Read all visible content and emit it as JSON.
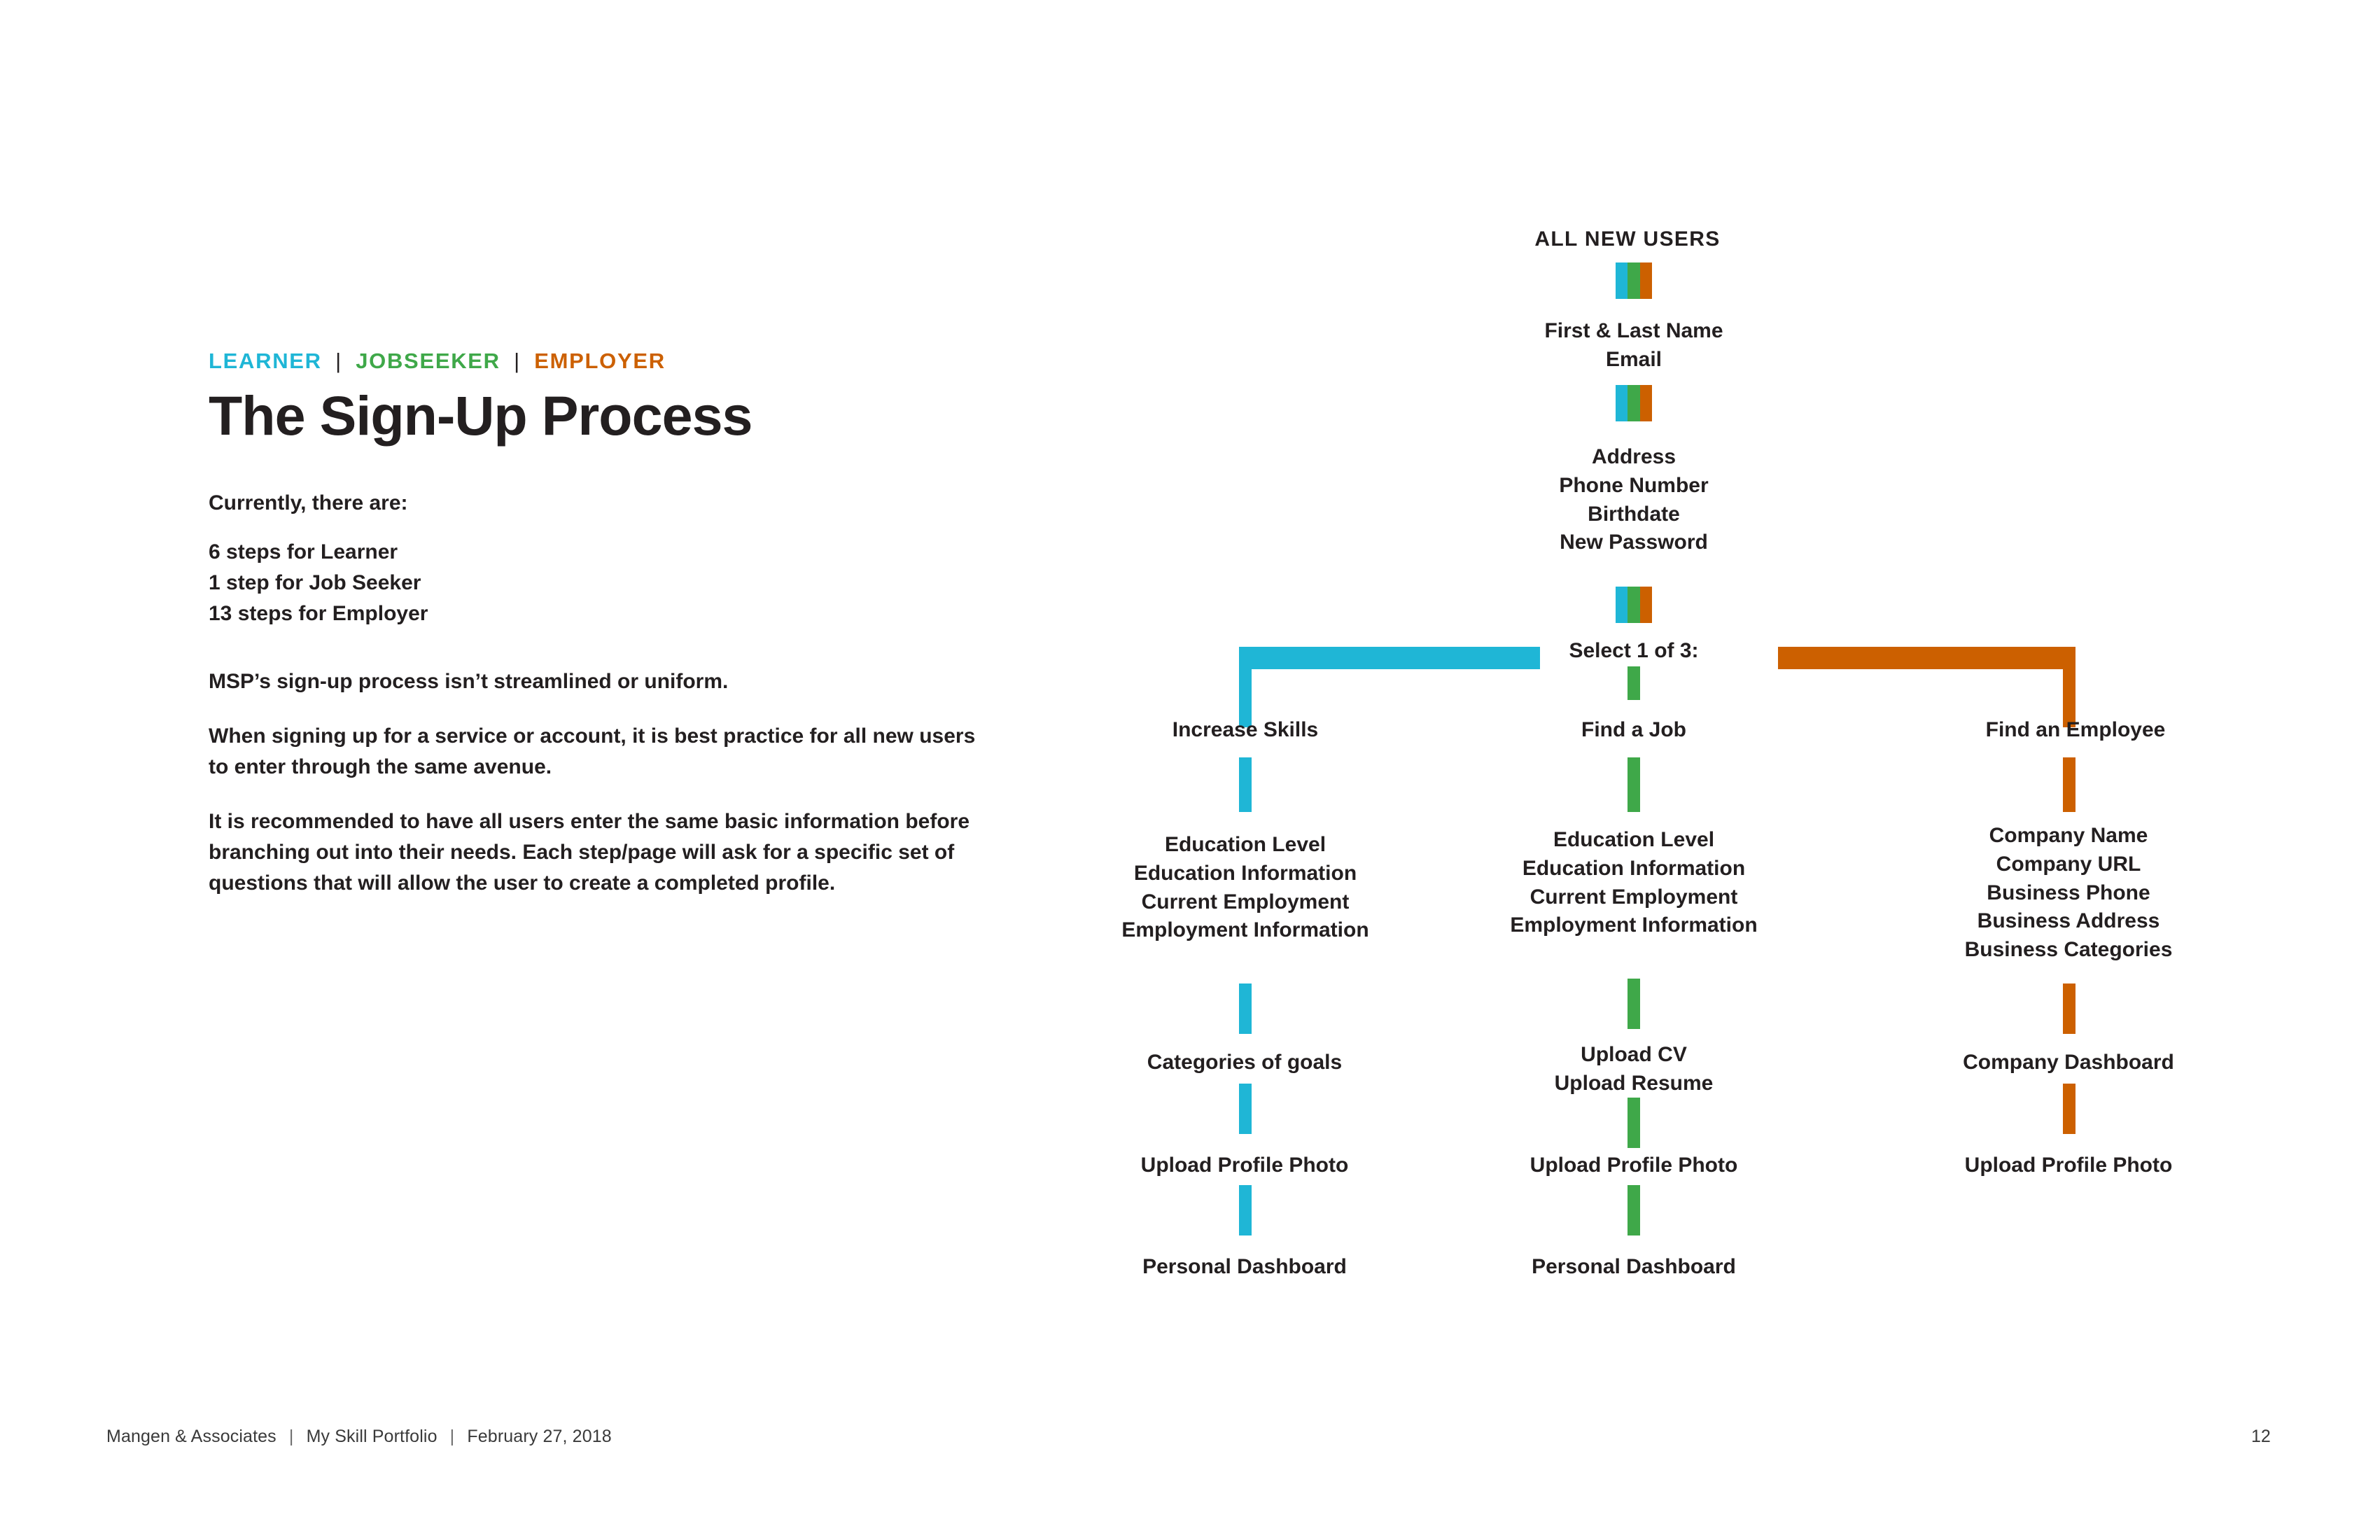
{
  "header": {
    "tags": [
      {
        "label": "LEARNER",
        "color": "#1fb6d6"
      },
      {
        "label": "JOBSEEKER",
        "color": "#3fa849"
      },
      {
        "label": "EMPLOYER",
        "color": "#cc6000"
      }
    ],
    "separator": "|",
    "title": "The Sign-Up Process"
  },
  "body": {
    "lead": "Currently, there are:",
    "steps": "6 steps for Learner\n1 step for Job Seeker\n13 steps for Employer",
    "para1": "MSP’s sign-up process isn’t streamlined or uniform.",
    "para2": "When signing up for a service or account, it is best practice for all new users to enter through the same avenue.",
    "para3": "It is recommended to have all users enter the same basic information before branching out into their needs. Each step/page will ask for a specific set of questions that will allow the user to create a completed profile."
  },
  "flow": {
    "heading": "ALL NEW USERS",
    "trunk": {
      "step1": "First & Last Name\nEmail",
      "step2": "Address\nPhone Number\nBirthdate\nNew Password",
      "select": "Select 1 of 3:"
    },
    "branches": [
      {
        "name": "learner",
        "color": "#1fb6d6",
        "title": "Increase Skills",
        "steps": [
          "Education Level\nEducation Information\nCurrent Employment\nEmployment Information",
          "Categories of goals",
          "Upload Profile Photo",
          "Personal Dashboard"
        ]
      },
      {
        "name": "jobseeker",
        "color": "#3fa849",
        "title": "Find a Job",
        "steps": [
          "Education Level\nEducation Information\nCurrent Employment\nEmployment Information",
          "Upload CV\nUpload Resume",
          "Upload Profile Photo",
          "Personal Dashboard"
        ]
      },
      {
        "name": "employer",
        "color": "#cc6000",
        "title": "Find an Employee",
        "steps": [
          "Company Name\nCompany URL\nBusiness Phone\nBusiness Address\nBusiness Categories",
          "Company Dashboard",
          "Upload Profile Photo",
          ""
        ]
      }
    ]
  },
  "footer": {
    "company": "Mangen & Associates",
    "project": "My Skill Portfolio",
    "date": "February 27, 2018",
    "separator": "|",
    "page_number": "12"
  }
}
